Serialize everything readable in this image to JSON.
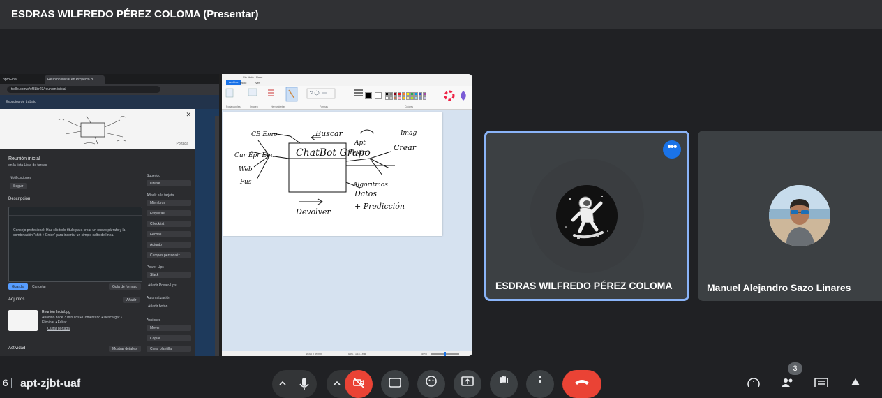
{
  "header": {
    "title": "ESDRAS WILFREDO PÉREZ COLOMA (Presentar)"
  },
  "shared_screen": {
    "trello": {
      "tabs": [
        "pproFinal",
        "Reunión inicial en Proyecto B..."
      ],
      "url": "trello.com/c/cf8Lbr23/reunion-inicial",
      "board_head": "Espacios de trabajo",
      "card_title": "Reunión inicial",
      "card_list": "en la lista Lista de tareas",
      "notifications_label": "Notificaciones",
      "follow_button": "Seguir",
      "description_label": "Descripción",
      "description_text": "Consejo profesional: Haz clic todo título para crear un nuevo párrafo y la combinación \"shift + Enter\" para insertar un simple salto de línea.",
      "save_button": "Guardar",
      "cancel_button": "Cancelar",
      "format_guide": "Guía de formato",
      "attachments_label": "Adjuntos",
      "add_button": "Añadir",
      "attachment_name": "Reunión Inicial.jpg",
      "attachment_meta": "Añadido hace 3 minutos • Comentario • Descargar • Eliminar • Editar",
      "remove_cover": "Quitar portada",
      "activity_label": "Actividad",
      "show_details": "Mostrar detalles",
      "cover_attach": "Portada",
      "side_header_suggested": "Sugerido",
      "side_join": "Unirse",
      "side_header_add": "Añadir a la tarjeta",
      "side_items": [
        "Miembros",
        "Etiquetas",
        "Checklist",
        "Fechas",
        "Adjunto",
        "Campos personaliz..."
      ],
      "side_header_powerups": "Power-Ups",
      "side_slack": "Slack",
      "side_add_powerups": "Añadir Power-Ups",
      "side_header_automation": "Automatización",
      "side_add_button": "Añadir botón",
      "side_header_actions": "Acciones",
      "side_actions": [
        "Mover",
        "Copiar",
        "Crear plantilla"
      ]
    },
    "paint": {
      "window_title": "Sin título - Paint",
      "menu": [
        "Archivo",
        "Inicio",
        "Ver"
      ],
      "groups": [
        "Portapapeles",
        "Imagen",
        "Herramientas",
        "Formas",
        "Colores"
      ],
      "status_left": "1648 x 969px",
      "status_mid": "Tam.: 153,1KB",
      "status_zoom": "50%",
      "sketch_words": {
        "center": "ChatBot Grupo",
        "buscar": "Buscar",
        "devolver": "Devolver",
        "crear": "Crear",
        "prediccion": "+ Predicción",
        "datos": "Datos"
      }
    }
  },
  "tiles": [
    {
      "name": "ESDRAS WILFREDO PÉREZ COLOMA",
      "active": true,
      "avatar": "astronaut-skateboard-avatar"
    },
    {
      "name": "Manuel Alejandro Sazo Linares",
      "active": false,
      "avatar": "beach-photo-avatar"
    }
  ],
  "bottom": {
    "meeting_code": "apt-zjbt-uaf",
    "participants_badge": "3"
  },
  "colors": {
    "accent": "#8ab4f8",
    "end_call": "#ea4335",
    "bg": "#202124",
    "tile": "#3c4043",
    "more": "#1a73e8"
  }
}
